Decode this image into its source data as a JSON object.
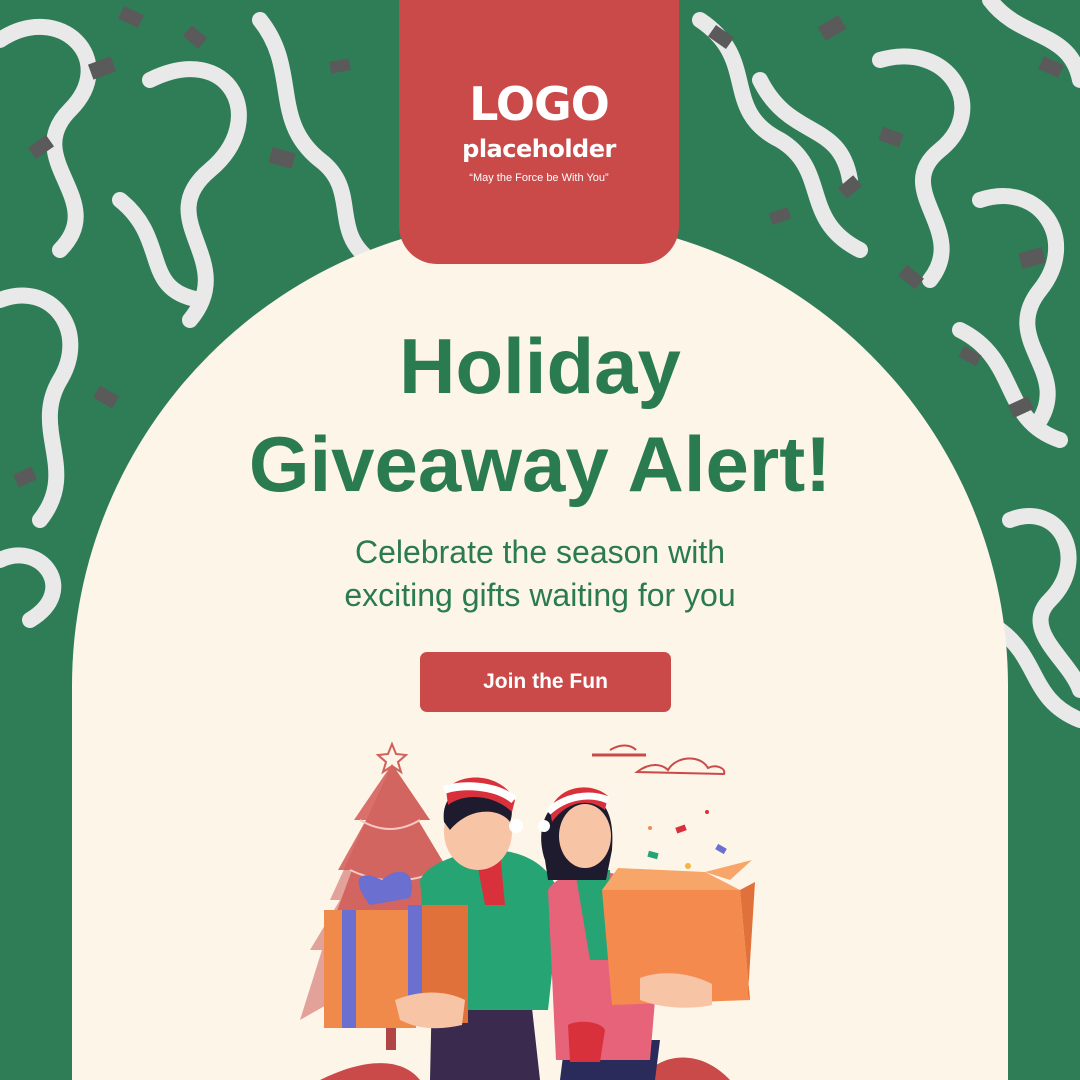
{
  "logo": {
    "main": "LOGO",
    "sub": "placeholder",
    "tagline": "“May the Force be With You”"
  },
  "headline": {
    "line1": "Holiday",
    "line2": "Giveaway Alert!"
  },
  "subheadline": {
    "line1": "Celebrate the season with",
    "line2": "exciting gifts waiting for you"
  },
  "cta": {
    "label": "Join the Fun"
  },
  "illustration": {
    "icons": [
      "streamer-icon",
      "confetti-icon",
      "christmas-tree-icon",
      "star-icon",
      "gift-box-icon",
      "open-box-icon",
      "santa-hat-icon",
      "cloud-icon"
    ]
  },
  "colors": {
    "background_green": "#2E7D57",
    "arch_cream": "#FDF5E8",
    "brand_red": "#C94A49",
    "headline_green": "#2B7B50",
    "white": "#FFFFFF",
    "streamer": "#E9E9E9",
    "confetti": "#5A5A5A"
  }
}
